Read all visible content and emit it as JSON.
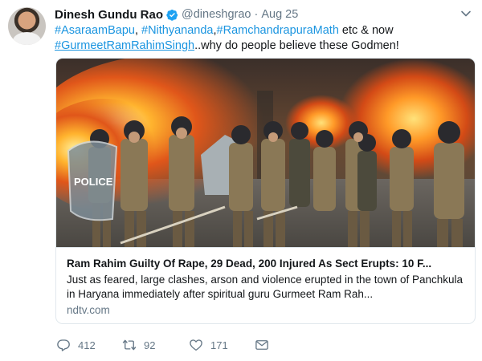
{
  "tweet": {
    "author_name": "Dinesh Gundu Rao",
    "handle": "@dineshgrao",
    "separator": "·",
    "date": "Aug 25",
    "text": {
      "tag1": "#AsaraamBapu",
      "sep1": ", ",
      "tag2": "#Nithyananda",
      "sep2": ",",
      "tag3": "#RamchandrapuraMath",
      "mid": " etc & now",
      "tag4": "#GurmeetRamRahimSingh",
      "end": "..why do people believe these Godmen!"
    },
    "card": {
      "image_sign_text": "POLICE",
      "title": "Ram Rahim Guilty Of Rape, 29 Dead, 200 Injured As Sect Erupts: 10 F...",
      "description": "Just as feared, large clashes, arson and violence erupted in the town of Panchkula in Haryana immediately after spiritual guru Gurmeet Ram Rah...",
      "domain": "ndtv.com"
    },
    "actions": {
      "reply_count": "412",
      "retweet_count": "92",
      "like_count": "171"
    }
  },
  "colors": {
    "link": "#1b95e0",
    "secondary_text": "#657786",
    "border": "#e1e8ed",
    "verified": "#1da1f2"
  },
  "icons": [
    "verified-icon",
    "chevron-down-icon",
    "reply-icon",
    "retweet-icon",
    "like-icon",
    "direct-message-icon"
  ]
}
